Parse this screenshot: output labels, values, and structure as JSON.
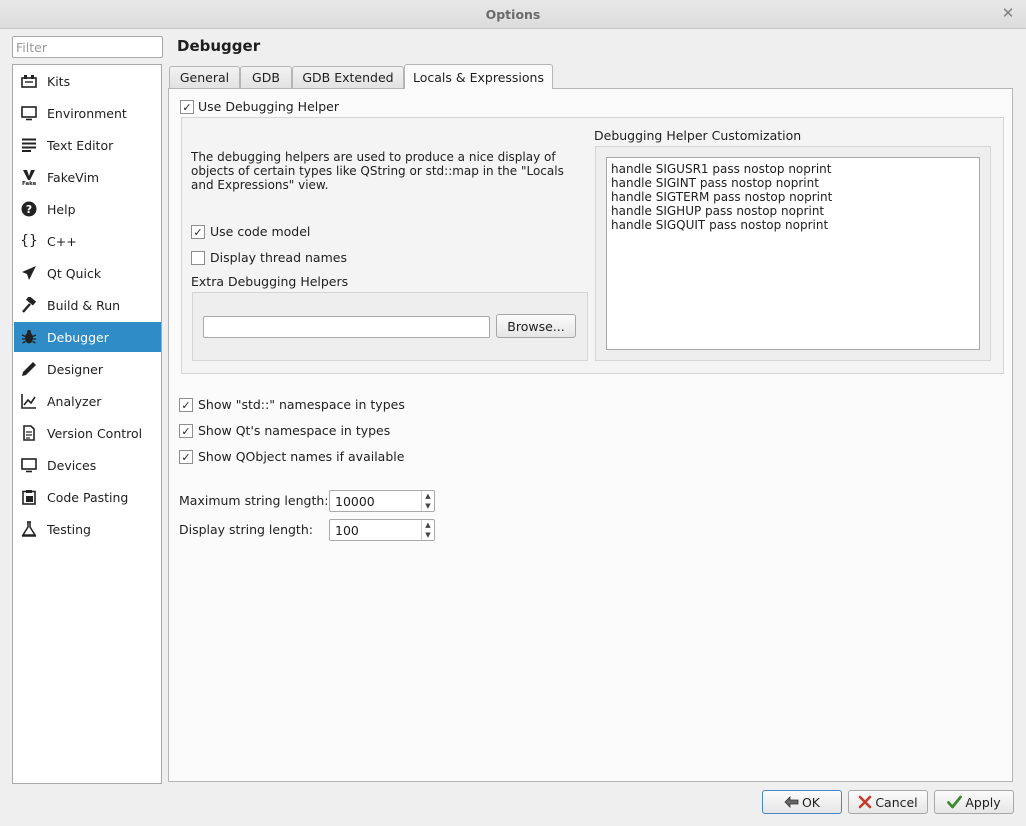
{
  "window": {
    "title": "Options"
  },
  "filter": {
    "placeholder": "Filter"
  },
  "sidebar": {
    "items": [
      {
        "label": "Kits"
      },
      {
        "label": "Environment"
      },
      {
        "label": "Text Editor"
      },
      {
        "label": "FakeVim"
      },
      {
        "label": "Help"
      },
      {
        "label": "C++"
      },
      {
        "label": "Qt Quick"
      },
      {
        "label": "Build & Run"
      },
      {
        "label": "Debugger"
      },
      {
        "label": "Designer"
      },
      {
        "label": "Analyzer"
      },
      {
        "label": "Version Control"
      },
      {
        "label": "Devices"
      },
      {
        "label": "Code Pasting"
      },
      {
        "label": "Testing"
      }
    ],
    "selected": "Debugger"
  },
  "page": {
    "title": "Debugger"
  },
  "tabs": [
    {
      "label": "General"
    },
    {
      "label": "GDB"
    },
    {
      "label": "GDB Extended"
    },
    {
      "label": "Locals & Expressions"
    }
  ],
  "locals": {
    "use_debugging_helper": {
      "label": "Use Debugging Helper",
      "checked": true
    },
    "description": "The debugging helpers are used to produce a nice display of objects of certain types like QString or std::map in the \"Locals and Expressions\" view.",
    "use_code_model": {
      "label": "Use code model",
      "checked": true
    },
    "display_thread_names": {
      "label": "Display thread names",
      "checked": false
    },
    "extra_helpers_label": "Extra Debugging Helpers",
    "extra_helpers_value": "",
    "browse_label": "Browse...",
    "customization_label": "Debugging Helper Customization",
    "customization_lines": [
      "handle SIGUSR1 pass nostop noprint",
      "handle SIGINT pass nostop noprint",
      "handle SIGTERM pass nostop noprint",
      "handle SIGHUP pass nostop noprint",
      "handle SIGQUIT pass nostop noprint"
    ],
    "show_std_namespace": {
      "label": "Show \"std::\" namespace in types",
      "checked": true
    },
    "show_qt_namespace": {
      "label": "Show Qt's namespace in types",
      "checked": true
    },
    "show_qobject_names": {
      "label": "Show QObject names if available",
      "checked": true
    },
    "max_string_length": {
      "label": "Maximum string length:",
      "value": "10000"
    },
    "display_string_length": {
      "label": "Display string length:",
      "value": "100"
    }
  },
  "buttons": {
    "ok": "OK",
    "cancel": "Cancel",
    "apply": "Apply"
  },
  "check_glyph": "✓",
  "accent_color": "#308cc6"
}
